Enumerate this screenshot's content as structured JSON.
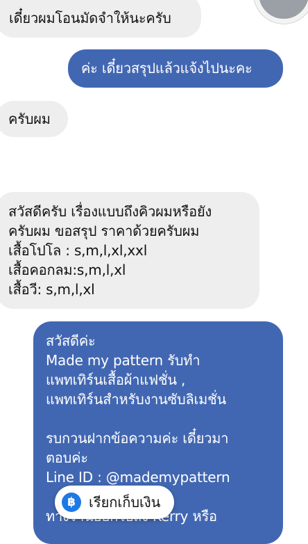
{
  "colors": {
    "incoming_bubble": "#eeeeee",
    "outgoing_bubble": "#4267b2",
    "outgoing_text": "#ffffff",
    "pay_icon": "#1e78e6"
  },
  "messages": [
    {
      "direction": "incoming",
      "text": "เดี๋ยวผมโอนมัดจำให้นะครับ"
    },
    {
      "direction": "outgoing",
      "text": "ค่ะ เดี๋ยวสรุปแล้วแจ้งไปนะคะ"
    },
    {
      "direction": "incoming",
      "text": "ครับผม"
    },
    {
      "direction": "incoming",
      "text": "สวัสดีครับ เรื่องแบบถึงคิวผมหรือยัง\nครับผม ขอสรุป ราคาด้วยครับผม\nเสื้อโปโล : s,m,l,xl,xxl\nเสื้อคอกลม:s,m,l,xl\nเสื้อวี: s,m,l,xl"
    },
    {
      "direction": "outgoing",
      "text": "สวัสดีค่ะ\nMade my pattern รับทำ\nแพทเทิร์นเสื้อผ้าแฟชั่น ,\nแพทเทิร์นสำหรับงานซับลิเมชั่น\n\nรบกวนฝากข้อความค่ะ เดี๋ยวมา\nตอบค่ะ\nLine ID : @mademypattern\n\nทางร้านออกใบส่ง Kerry หรือ"
    }
  ],
  "payment_button": {
    "icon": "baht-coin-icon",
    "icon_glyph": "฿",
    "label": "เรียกเก็บเงิน"
  }
}
